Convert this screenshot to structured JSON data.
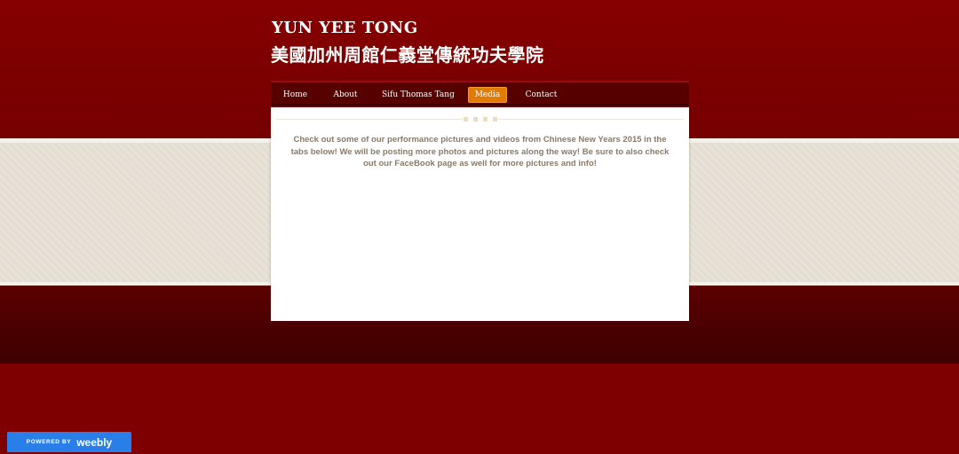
{
  "header": {
    "title": "YUN YEE TONG",
    "subtitle": "美國加州周館仁義堂傳統功夫學院"
  },
  "nav": {
    "items": [
      {
        "label": "Home",
        "active": false
      },
      {
        "label": "About",
        "active": false
      },
      {
        "label": "Sifu Thomas Tang",
        "active": false
      },
      {
        "label": "Media",
        "active": true
      },
      {
        "label": "Contact",
        "active": false
      }
    ]
  },
  "main": {
    "intro_text": "Check out some of our performance pictures and videos from Chinese New Years 2015 in the tabs below! We will be posting more photos and pictures along the way! Be sure to also check out our FaceBook page as well for more pictures and info!"
  },
  "footer_badge": {
    "powered_label": "POWERED BY",
    "brand": "weebly"
  },
  "colors": {
    "background_red": "#7a0000",
    "band_light": "#e4ddd2",
    "band_dark": "#3d0000",
    "nav_bg": "#560000",
    "nav_active": "#e17b05",
    "text_muted": "#8a7a66",
    "badge_blue": "#2a7ee8"
  }
}
